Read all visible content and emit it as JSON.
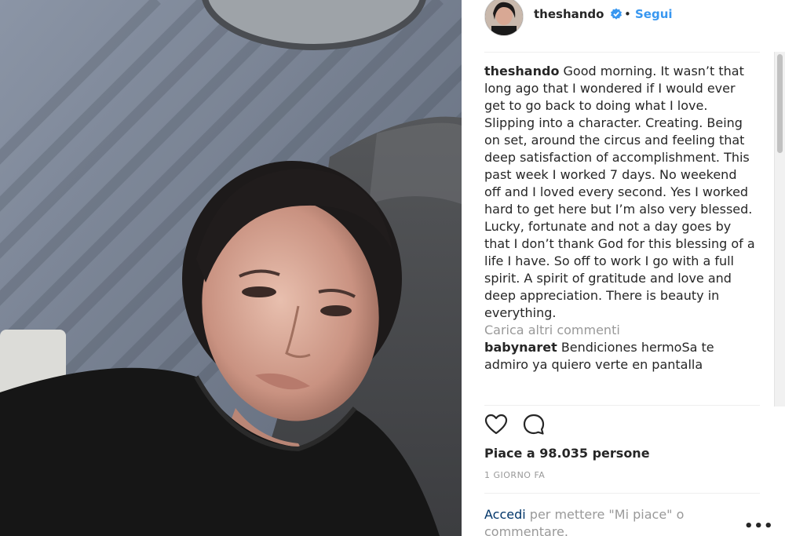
{
  "post": {
    "username": "theshando",
    "dot": "•",
    "follow_label": "Segui",
    "caption_username": "theshando",
    "caption_text": "Good morning. It wasn’t that long ago that I wondered if I would ever get to go back to doing what I love. Slipping into a character. Creating. Being on set, around the circus and feeling that deep satisfaction of accomplishment. This past week I worked 7 days. No weekend off and I loved every second. Yes I worked hard to get here but I’m also very blessed. Lucky, fortunate and not a day goes by that I don’t thank God for this blessing of a life I have. So off to work I go with a full spirit. A spirit of gratitude and love and deep appreciation. There is beauty in everything.",
    "load_more_label": "Carica altri commenti",
    "comments": [
      {
        "username": "babynaret",
        "text": "Bendiciones hermoSa te admiro ya quiero verte en pantalla"
      }
    ],
    "likes_text": "Piace a 98.035 persone",
    "timestamp": "1 GIORNO FA",
    "login_link": "Accedi",
    "login_rest": " per mettere \"Mi piace\" o commentare.",
    "more_options": "•••"
  },
  "icons": {
    "like": "heart-icon",
    "comment": "comment-bubble-icon",
    "verified": "verified-badge-icon"
  },
  "colors": {
    "link": "#3897f0",
    "verified": "#3897f0",
    "text": "#262626",
    "muted": "#999999"
  }
}
